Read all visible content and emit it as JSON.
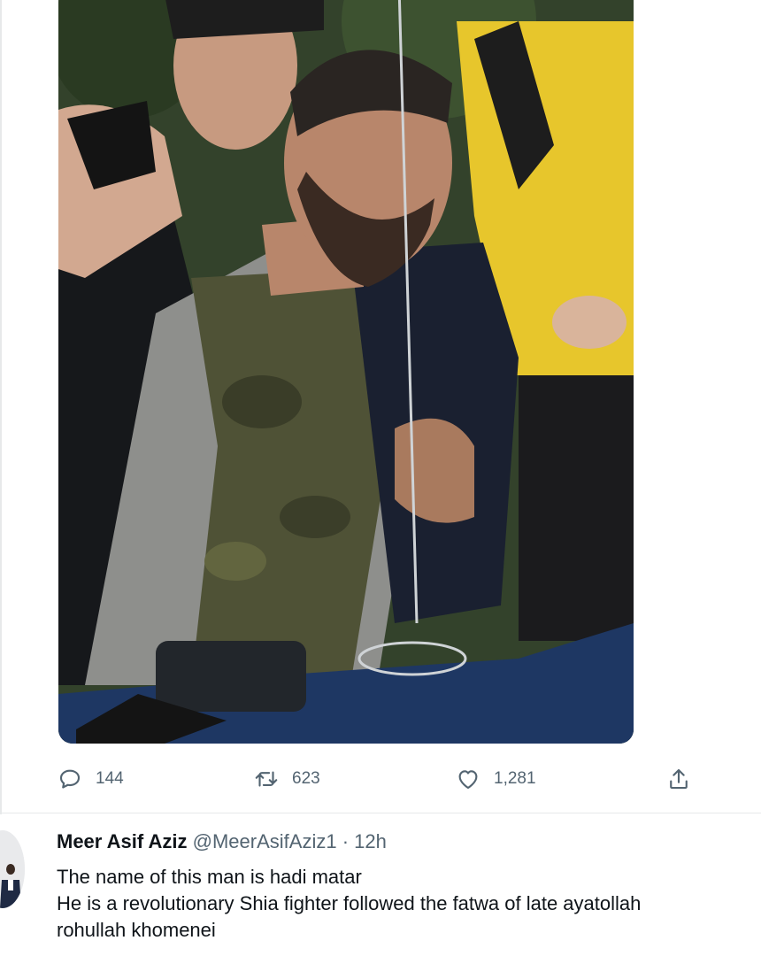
{
  "tweet": {
    "photo_icon": "photo-of-person",
    "stats": {
      "replies": "144",
      "retweets": "623",
      "likes": "1,281"
    },
    "icons": {
      "reply": "speech-bubble-icon",
      "retweet": "retweet-arrows-icon",
      "like": "heart-icon",
      "share": "share-upload-icon"
    }
  },
  "reply": {
    "author_name": "Meer Asif Aziz",
    "author_handle": "@MeerAsifAziz1",
    "separator": "·",
    "timestamp": "12h",
    "lines": [
      "The name of this man is hadi matar",
      "He is a revolutionary Shia fighter followed the fatwa of late ayatollah",
      "rohullah khomenei"
    ]
  },
  "colors": {
    "icon_gray": "#536471",
    "text": "#0f1419",
    "divider": "#e7e9ea"
  }
}
